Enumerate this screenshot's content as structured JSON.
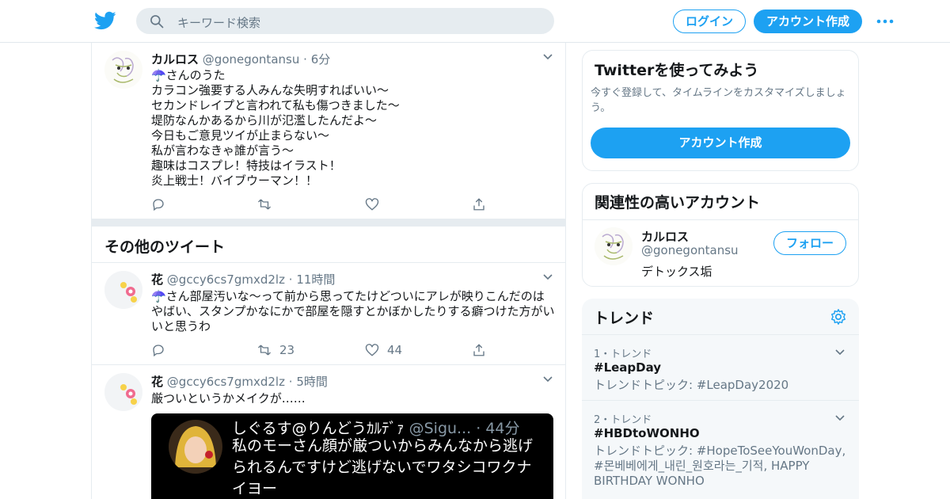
{
  "header": {
    "search_placeholder": "キーワード検索",
    "login_label": "ログイン",
    "signup_label": "アカウント作成",
    "brand_color": "#1da1f2"
  },
  "main": {
    "tweets_top": [
      {
        "name": "カルロス",
        "handle": "@gonegontansu",
        "time": "6分",
        "lines": [
          "☂️さんのうた",
          "カラコン強要する人みんな失明すればいい〜",
          "セカンドレイプと言われて私も傷つきました〜",
          "堤防なんかあるから川が氾濫したんだよ〜",
          "今日もご意見ツイが止まらない〜",
          "私が言わなきゃ誰が言う〜",
          "趣味はコスプレ！特技はイラスト！",
          "炎上戦士！バイブウーマン！！"
        ]
      }
    ],
    "section_title": "その他のツイート",
    "tweets_more": [
      {
        "name": "花",
        "handle": "@gccy6cs7gmxd2lz",
        "time": "11時間",
        "text": "☂️さん部屋汚いな〜って前から思ってたけどついにアレが映りこんだのはやばい、スタンプかなにかで部屋を隠すとかぼかしたりする癖つけた方がいいと思うわ",
        "retweets": "23",
        "likes": "44"
      },
      {
        "name": "花",
        "handle": "@gccy6cs7gmxd2lz",
        "time": "5時間",
        "text": "厳ついというかメイクが……",
        "embed": {
          "name": "しぐるす@りんどうｶﾙﾃﾞｧ",
          "handle": "@Sigu...",
          "time": "44分",
          "text": "私のモーさん顔が厳ついからみんなから逃げられるんですけど逃げないでワタシコワクナイヨー"
        }
      }
    ]
  },
  "sidebar": {
    "signup_card": {
      "title": "Twitterを使ってみよう",
      "subtitle": "今すぐ登録して、タイムラインをカスタマイズしましょう。",
      "button": "アカウント作成"
    },
    "related": {
      "title": "関連性の高いアカウント",
      "name": "カルロス",
      "handle": "@gonegontansu",
      "bio": "デトックス垢",
      "follow_label": "フォロー"
    },
    "trends": {
      "title": "トレンド",
      "items": [
        {
          "rank": "1・トレンド",
          "name": "#LeapDay",
          "desc": "トレンドトピック: #LeapDay2020"
        },
        {
          "rank": "2・トレンド",
          "name": "#HBDtoWONHO",
          "desc": "トレンドトピック: #HopeToSeeYouWonDay, #몬베베에게_내린_원호라는_기적, HAPPY BIRTHDAY WONHO"
        }
      ]
    }
  }
}
